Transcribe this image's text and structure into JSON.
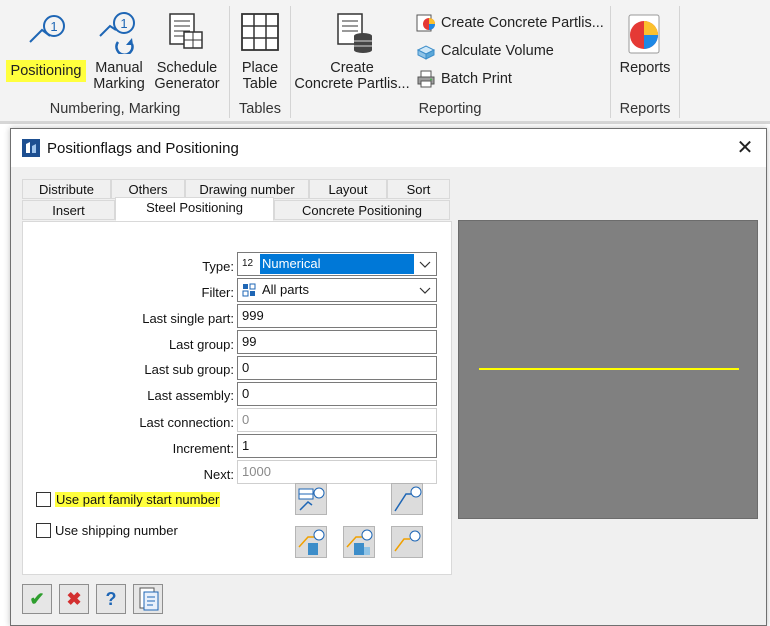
{
  "ribbon": {
    "numbering_group": {
      "label": "Numbering, Marking",
      "positioning": "Positioning",
      "manual_marking_1": "Manual",
      "manual_marking_2": "Marking",
      "schedule_generator_1": "Schedule",
      "schedule_generator_2": "Generator"
    },
    "tables_group": {
      "label": "Tables",
      "place_table_1": "Place",
      "place_table_2": "Table"
    },
    "reporting_group": {
      "label": "Reporting",
      "create_partlist_1": "Create",
      "create_partlist_2": "Concrete Partlis...",
      "create_partlist_small": "Create Concrete Partlis...",
      "calculate_volume": "Calculate Volume",
      "batch_print": "Batch Print"
    },
    "reports_group": {
      "label": "Reports",
      "reports": "Reports"
    },
    "highlight_color": "#ffff3d"
  },
  "dialog": {
    "title": "Positionflags and Positioning",
    "close_glyph": "✕",
    "tabs_row1": [
      "Distribute",
      "Others",
      "Drawing number",
      "Layout",
      "Sort"
    ],
    "tabs_row2": [
      "Insert",
      "Steel Positioning",
      "Concrete Positioning"
    ],
    "active_tab": "Steel Positioning",
    "fields": {
      "type_label": "Type:",
      "type_value": "Numerical",
      "type_icon": "12",
      "filter_label": "Filter:",
      "filter_value": "All parts",
      "last_single_part_label": "Last single part:",
      "last_single_part_value": "999",
      "last_group_label": "Last group:",
      "last_group_value": "99",
      "last_sub_group_label": "Last sub group:",
      "last_sub_group_value": "0",
      "last_assembly_label": "Last assembly:",
      "last_assembly_value": "0",
      "last_connection_label": "Last connection:",
      "last_connection_value": "0",
      "increment_label": "Increment:",
      "increment_value": "1",
      "next_label": "Next:",
      "next_value": "1000"
    },
    "checkboxes": {
      "use_part_family_label": "Use part family start number",
      "use_part_family_checked": false,
      "use_shipping_label": "Use shipping number",
      "use_shipping_checked": false
    },
    "preview": {
      "background": "#808080",
      "line_color": "#ffff00"
    },
    "bottom_buttons": {
      "ok": "✔",
      "cancel": "✖",
      "help": "?"
    }
  }
}
